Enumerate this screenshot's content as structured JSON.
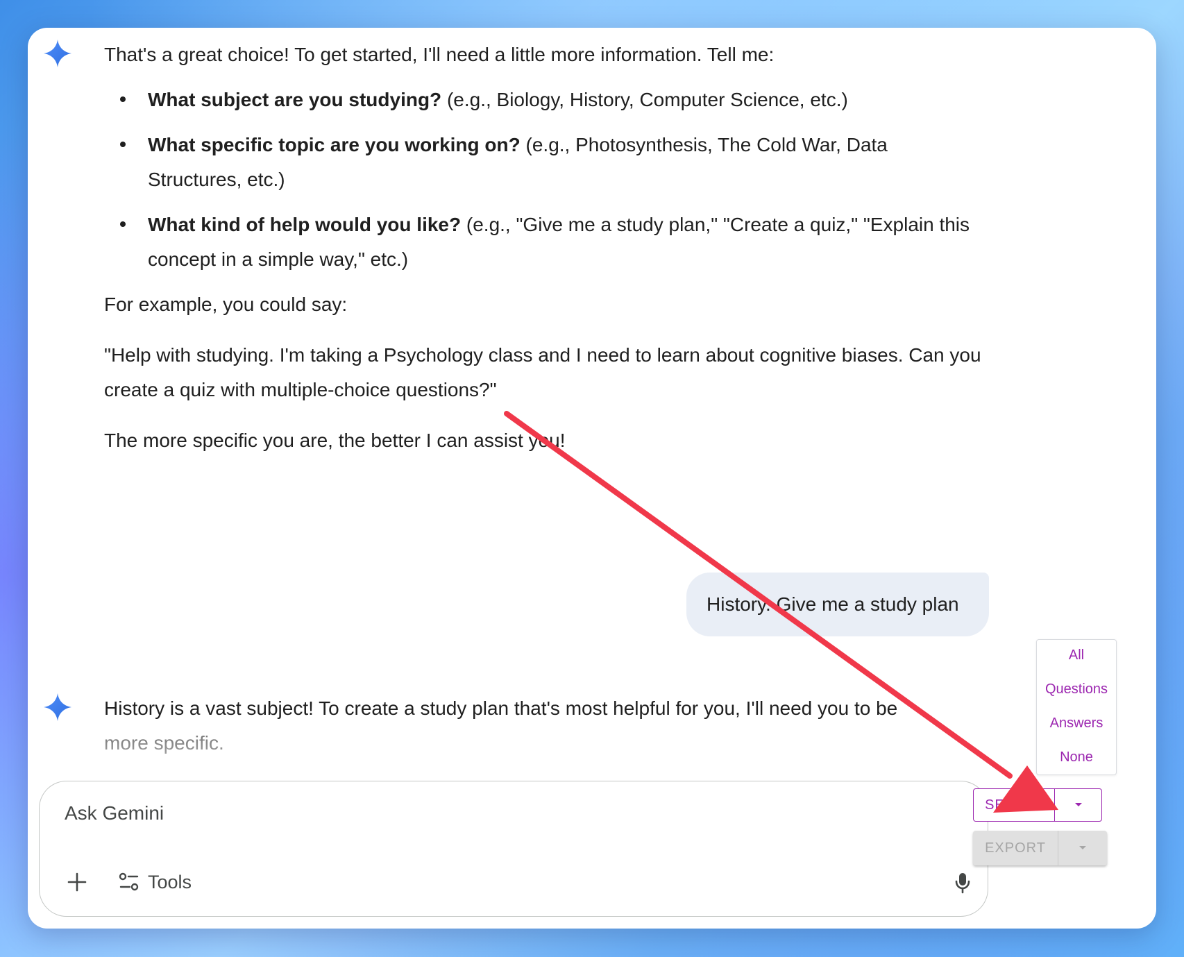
{
  "response1": {
    "intro": "That's a great choice! To get started, I'll need a little more information. Tell me:",
    "bullets": [
      {
        "bold": "What subject are you studying?",
        "rest": " (e.g., Biology, History, Computer Science, etc.)"
      },
      {
        "bold": "What specific topic are you working on?",
        "rest": " (e.g., Photosynthesis, The Cold War, Data Structures, etc.)"
      },
      {
        "bold": "What kind of help would you like?",
        "rest": " (e.g., \"Give me a study plan,\" \"Create a quiz,\" \"Explain this concept in a simple way,\" etc.)"
      }
    ],
    "example_intro": "For example, you could say:",
    "example_quote": "\"Help with studying. I'm taking a Psychology class and I need to learn about cognitive biases. Can you create a quiz with multiple-choice questions?\"",
    "closing": "The more specific you are, the better I can assist you!"
  },
  "user_message": "History. Give me a study plan",
  "response2": {
    "text": "History is a vast subject! To create a study plan that's most helpful for you, I'll need you to be",
    "text_faded": "more specific."
  },
  "input": {
    "placeholder": "Ask Gemini",
    "tools_label": "Tools"
  },
  "select_menu": {
    "items": [
      "All",
      "Questions",
      "Answers",
      "None"
    ]
  },
  "buttons": {
    "select_label": "SELECT",
    "export_label": "EXPORT"
  },
  "colors": {
    "accent_purple": "#9c27b0",
    "arrow_red": "#f0384a",
    "bubble_bg": "#e9eef6"
  },
  "icons": [
    "gemini-spark-icon",
    "plus-icon",
    "tools-icon",
    "mic-icon",
    "caret-down-icon"
  ]
}
